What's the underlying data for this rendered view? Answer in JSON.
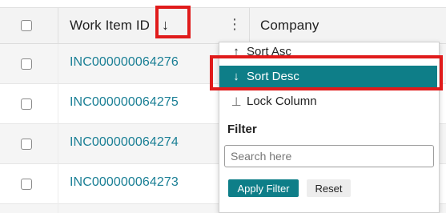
{
  "header": {
    "work_item_label": "Work Item ID",
    "sort_indicator": "↓",
    "menu_dots": "⋮",
    "company_label": "Company"
  },
  "rows": [
    {
      "id": "INC000000064276"
    },
    {
      "id": "INC000000064275"
    },
    {
      "id": "INC000000064274"
    },
    {
      "id": "INC000000064273"
    }
  ],
  "menu": {
    "sort_asc": {
      "icon": "↑",
      "label": "Sort Asc"
    },
    "sort_desc": {
      "icon": "↓",
      "label": "Sort Desc"
    },
    "lock_column": {
      "icon": "⊥",
      "label": "Lock Column"
    },
    "filter_title": "Filter",
    "search_placeholder": "Search here",
    "apply_label": "Apply Filter",
    "reset_label": "Reset"
  },
  "colors": {
    "link": "#1a7f95",
    "accent": "#0e7e88",
    "highlight": "#e01b1b"
  }
}
